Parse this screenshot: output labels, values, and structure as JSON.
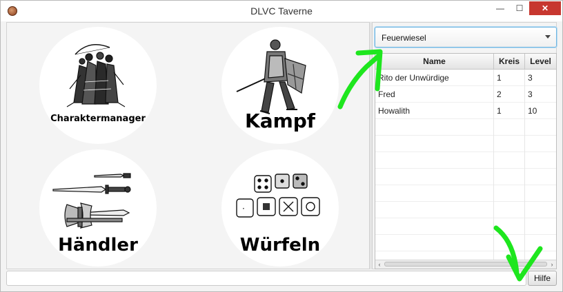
{
  "window": {
    "title": "DLVC Taverne",
    "minimize_glyph": "—",
    "maximize_glyph": "☐",
    "close_glyph": "✕"
  },
  "menu": {
    "tiles": [
      {
        "label": "Charaktermanager",
        "icon": "adventurer-party-illustration"
      },
      {
        "label": "Kampf",
        "icon": "knight-warrior-illustration"
      },
      {
        "label": "Händler",
        "icon": "weapons-illustration"
      },
      {
        "label": "Würfeln",
        "icon": "dice-illustration"
      }
    ]
  },
  "group_select": {
    "value": "Feuerwiesel"
  },
  "table": {
    "columns": [
      "Name",
      "Kreis",
      "Level"
    ],
    "rows": [
      {
        "name": "Rito der Unwürdige",
        "kreis": "1",
        "level": "3"
      },
      {
        "name": "Fred",
        "kreis": "2",
        "level": "3"
      },
      {
        "name": "Howalith",
        "kreis": "1",
        "level": "10"
      }
    ],
    "empty_rows": 9,
    "scroll_left": "‹",
    "scroll_right": "›"
  },
  "footer": {
    "status_text": "",
    "help_label": "Hilfe"
  },
  "colors": {
    "annotation": "#1ee61e",
    "close_button": "#c7372f",
    "focus_border": "#6fb5e0"
  }
}
